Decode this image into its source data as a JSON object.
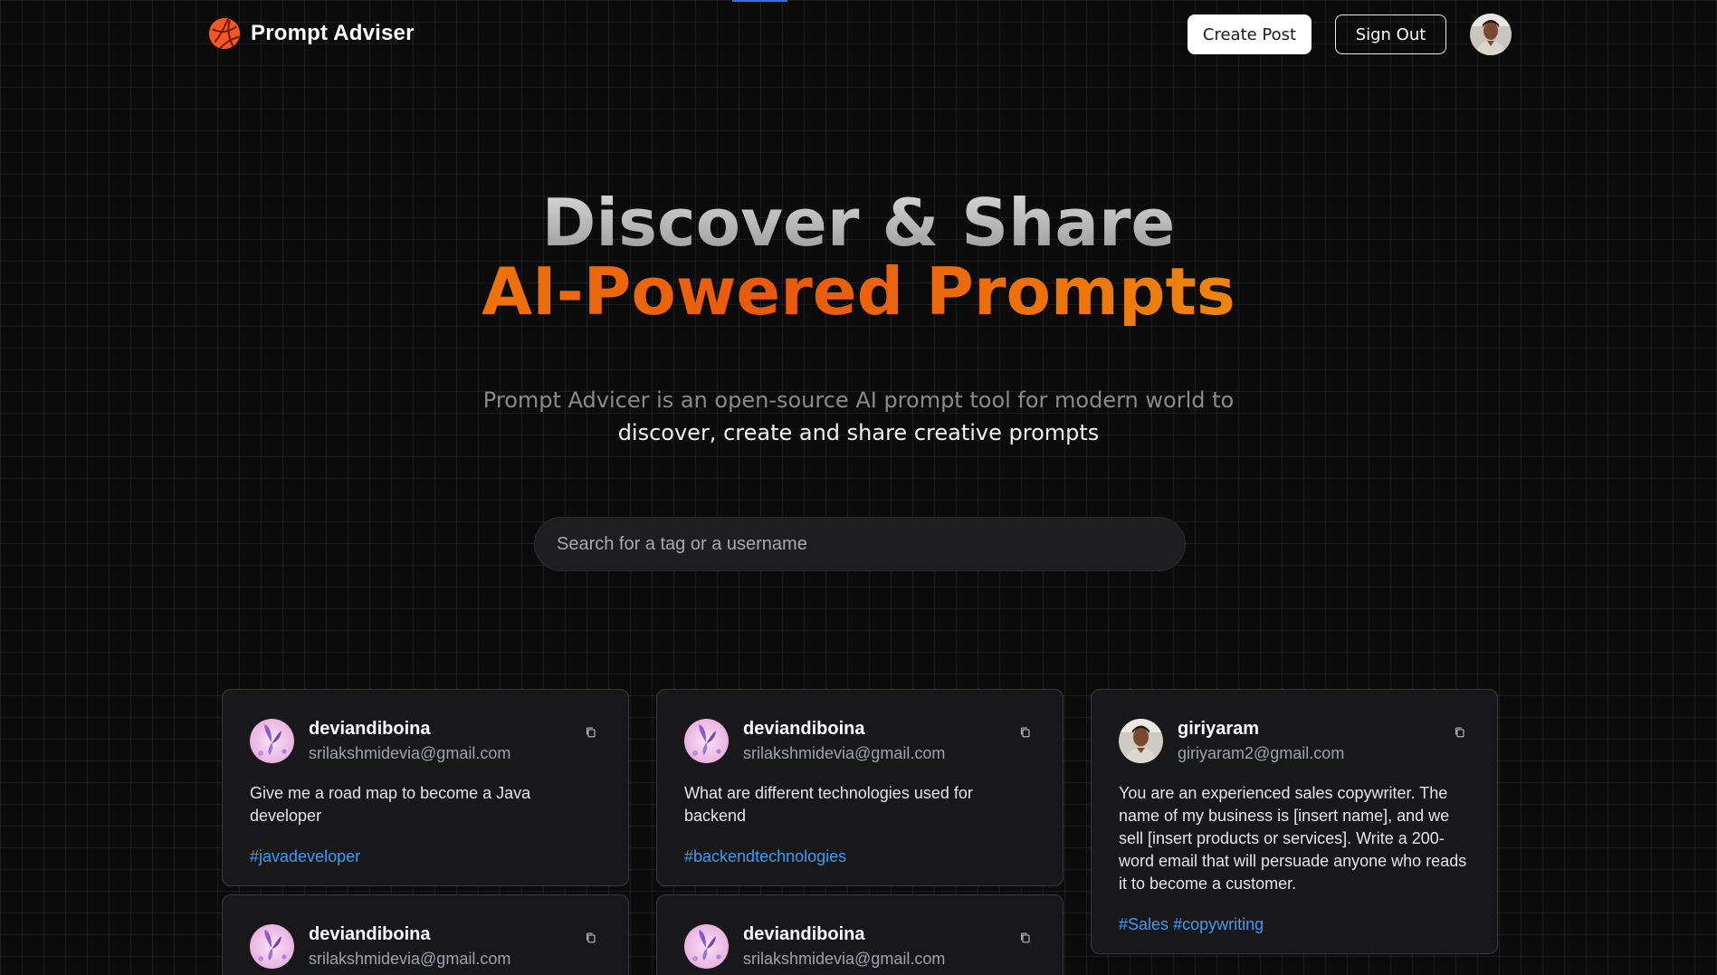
{
  "nav": {
    "brand_name": "Prompt Adviser",
    "create_post_label": "Create Post",
    "sign_out_label": "Sign Out"
  },
  "hero": {
    "title_line1": "Discover & Share",
    "title_line2": "AI-Powered Prompts",
    "desc_line1": "Prompt Advicer is an open-source AI prompt tool for modern world to",
    "desc_line2": "discover, create and share creative prompts"
  },
  "search": {
    "placeholder": "Search for a tag or a username",
    "value": ""
  },
  "cards": [
    {
      "username": "deviandiboina",
      "email": "srilakshmidevia@gmail.com",
      "prompt": "Give me a road map to become a Java developer",
      "tags": [
        "#javadeveloper"
      ],
      "avatar_icon": "butterfly-avatar-icon"
    },
    {
      "username": "deviandiboina",
      "email": "srilakshmidevia@gmail.com",
      "prompt": "What are different technologies used for backend",
      "tags": [
        "#backendtechnologies"
      ],
      "avatar_icon": "butterfly-avatar-icon"
    },
    {
      "username": "giriyaram",
      "email": "giriyaram2@gmail.com",
      "prompt": "You are an experienced sales copywriter. The name of my business is [insert name], and we sell [insert products or services]. Write a 200-word email that will persuade anyone who reads it to become a customer.",
      "tags": [
        "#Sales",
        "#copywriting"
      ],
      "avatar_icon": "person-avatar-icon"
    },
    {
      "username": "deviandiboina",
      "email": "srilakshmidevia@gmail.com",
      "prompt": "",
      "tags": [],
      "avatar_icon": "butterfly-avatar-icon"
    },
    {
      "username": "deviandiboina",
      "email": "srilakshmidevia@gmail.com",
      "prompt": "",
      "tags": [],
      "avatar_icon": "butterfly-avatar-icon"
    }
  ],
  "colors": {
    "background": "#0b0b0c",
    "accent_orange": "#ea580c",
    "tag_blue": "#3b9cf0",
    "card_bg": "#18181b"
  }
}
